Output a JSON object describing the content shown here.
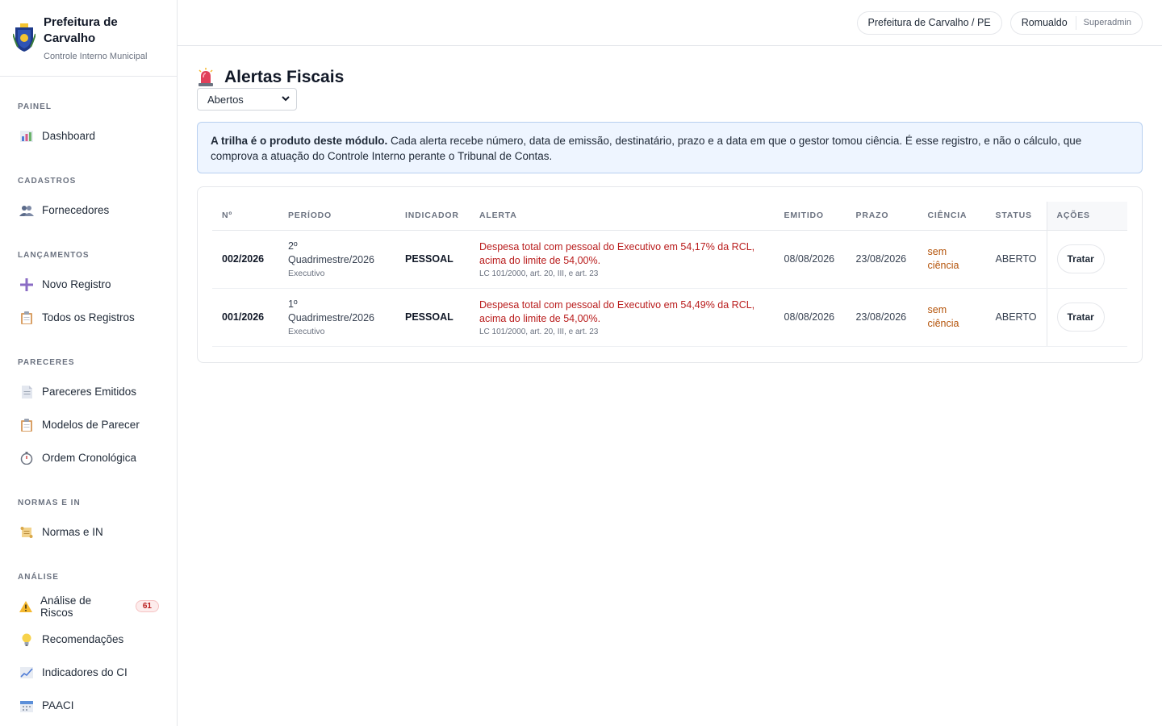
{
  "brand": {
    "title": "Prefeitura de Carvalho",
    "subtitle": "Controle Interno Municipal",
    "logo_icon": "coat-of-arms-icon"
  },
  "sidebar": {
    "sections": [
      {
        "title": "PAINEL",
        "items": [
          {
            "label": "Dashboard",
            "icon": "chart-icon"
          }
        ]
      },
      {
        "title": "CADASTROS",
        "items": [
          {
            "label": "Fornecedores",
            "icon": "users-icon"
          }
        ]
      },
      {
        "title": "LANÇAMENTOS",
        "items": [
          {
            "label": "Novo Registro",
            "icon": "plus-icon"
          },
          {
            "label": "Todos os Registros",
            "icon": "clipboard-icon"
          }
        ]
      },
      {
        "title": "PARECERES",
        "items": [
          {
            "label": "Pareceres Emitidos",
            "icon": "document-icon"
          },
          {
            "label": "Modelos de Parecer",
            "icon": "clipboard-icon"
          },
          {
            "label": "Ordem Cronológica",
            "icon": "stopwatch-icon"
          }
        ]
      },
      {
        "title": "NORMAS E IN",
        "items": [
          {
            "label": "Normas e IN",
            "icon": "scroll-icon"
          }
        ]
      },
      {
        "title": "ANÁLISE",
        "items": [
          {
            "label": "Análise de Riscos",
            "icon": "warning-icon",
            "badge": "61"
          },
          {
            "label": "Recomendações",
            "icon": "lightbulb-icon"
          },
          {
            "label": "Indicadores do CI",
            "icon": "trend-icon"
          },
          {
            "label": "PAACI",
            "icon": "calendar-icon"
          }
        ]
      }
    ]
  },
  "topbar": {
    "org": "Prefeitura de Carvalho / PE",
    "user_name": "Romualdo",
    "user_role": "Superadmin"
  },
  "page": {
    "title": "Alertas Fiscais",
    "filter_value": "Abertos",
    "info_bold": "A trilha é o produto deste módulo.",
    "info_text": " Cada alerta recebe número, data de emissão, destinatário, prazo e a data em que o gestor tomou ciência. É esse registro, e não o cálculo, que comprova a atuação do Controle Interno perante o Tribunal de Contas."
  },
  "table": {
    "headers": [
      "Nº",
      "PERÍODO",
      "INDICADOR",
      "ALERTA",
      "EMITIDO",
      "PRAZO",
      "CIÊNCIA",
      "STATUS",
      "AÇÕES"
    ],
    "rows": [
      {
        "num": "002/2026",
        "period_a": "2º",
        "period_b": "Quadrimestre/2026",
        "period_sub": "Executivo",
        "indicator": "PESSOAL",
        "alert": "Despesa total com pessoal do Executivo em 54,17% da RCL, acima do limite de 54,00%.",
        "alert_ref": "LC 101/2000, art. 20, III, e art. 23",
        "emitted": "08/08/2026",
        "deadline": "23/08/2026",
        "ciencia_a": "sem",
        "ciencia_b": "ciência",
        "status": "ABERTO",
        "action": "Tratar"
      },
      {
        "num": "001/2026",
        "period_a": "1º",
        "period_b": "Quadrimestre/2026",
        "period_sub": "Executivo",
        "indicator": "PESSOAL",
        "alert": "Despesa total com pessoal do Executivo em 54,49% da RCL, acima do limite de 54,00%.",
        "alert_ref": "LC 101/2000, art. 20, III, e art. 23",
        "emitted": "08/08/2026",
        "deadline": "23/08/2026",
        "ciencia_a": "sem",
        "ciencia_b": "ciência",
        "status": "ABERTO",
        "action": "Tratar"
      }
    ]
  },
  "colors": {
    "alert_red": "#b91c1c",
    "ciencia_orange": "#b45309",
    "info_bg": "#eef5ff",
    "badge_red": "#b91c1c"
  }
}
